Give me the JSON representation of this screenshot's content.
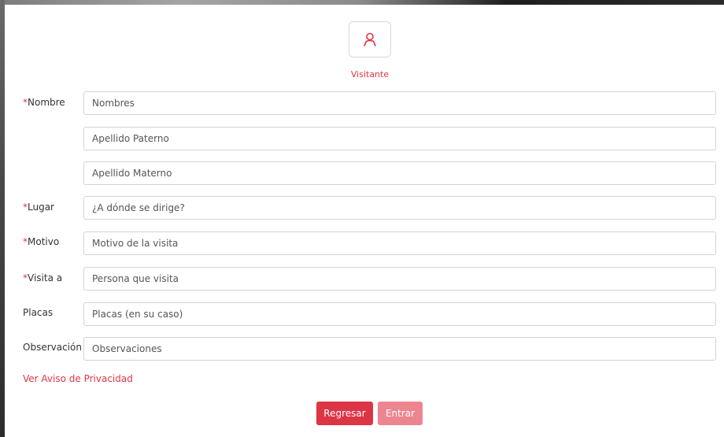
{
  "header": {
    "avatar_icon": "user-icon",
    "caption": "Visitante"
  },
  "colors": {
    "accent": "#dc3545",
    "accent_disabled": "#ec8590",
    "border": "#cfd4da"
  },
  "form": {
    "required_mark": "*",
    "nombre": {
      "label": "Nombre",
      "placeholder_nombres": "Nombres",
      "placeholder_paterno": "Apellido Paterno",
      "placeholder_materno": "Apellido Materno"
    },
    "lugar": {
      "label": "Lugar",
      "placeholder": "¿A dónde se dirige?"
    },
    "motivo": {
      "label": "Motivo",
      "placeholder": "Motivo de la visita"
    },
    "visita": {
      "label": "Visita a",
      "placeholder": "Persona que visita"
    },
    "placas": {
      "label": "Placas",
      "placeholder": "Placas (en su caso)"
    },
    "observacion": {
      "label": "Observación",
      "placeholder": "Observaciones"
    }
  },
  "privacy_link": "Ver Aviso de Privacidad",
  "buttons": {
    "back": "Regresar",
    "enter": "Entrar"
  }
}
